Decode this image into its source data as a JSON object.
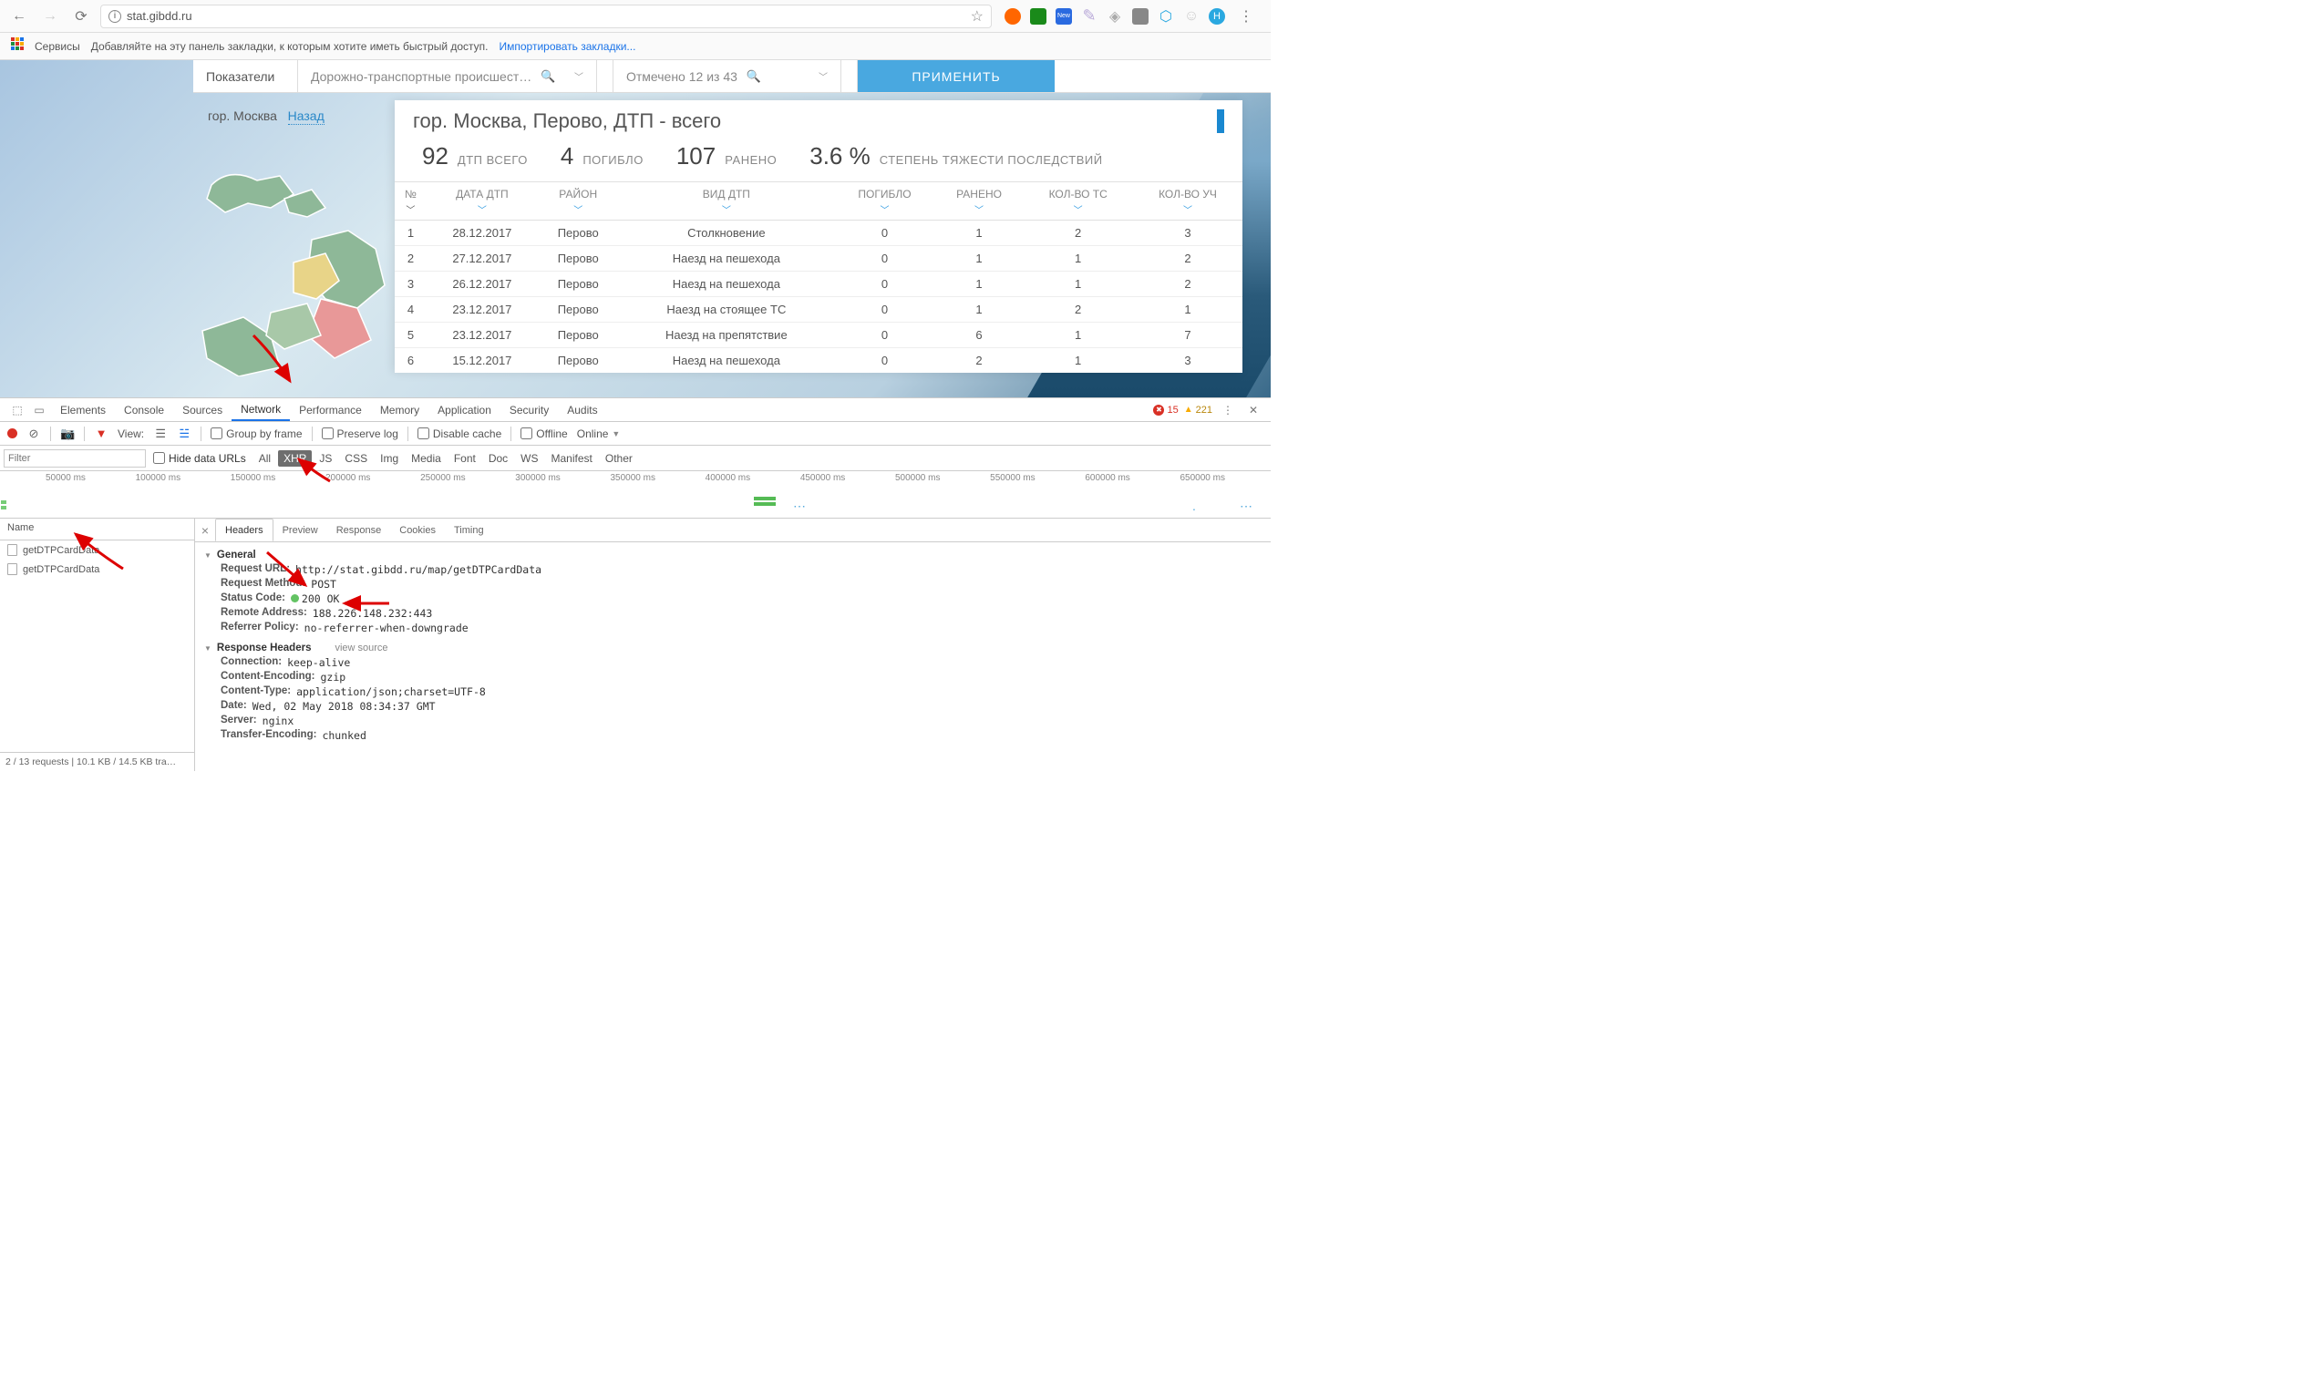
{
  "browser": {
    "url": "stat.gibdd.ru",
    "star_icon": "☆",
    "ext_icons": [
      "dots",
      "orange",
      "green",
      "blue-new",
      "lavender",
      "grey-tri",
      "evernote",
      "shield",
      "ghost",
      "H"
    ]
  },
  "bookmarks": {
    "services_label": "Сервисы",
    "hint_text": "Добавляйте на эту панель закладки, к которым хотите иметь быстрый доступ.",
    "import_link": "Импортировать закладки..."
  },
  "top_controls": {
    "indicators": "Показатели",
    "dtp_filter": "Дорожно-транспортные происшест…",
    "selected": "Отмечено 12 из 43",
    "apply": "ПРИМЕНИТЬ"
  },
  "breadcrumb": {
    "city": "гор. Москва",
    "back": "Назад"
  },
  "panel": {
    "title": "гор. Москва, Перово, ДТП - всего",
    "stats": [
      {
        "n": "92",
        "lbl": "ДТП ВСЕГО"
      },
      {
        "n": "4",
        "lbl": "ПОГИБЛО"
      },
      {
        "n": "107",
        "lbl": "РАНЕНО"
      },
      {
        "n": "3.6 %",
        "lbl": "СТЕПЕНЬ ТЯЖЕСТИ ПОСЛЕДСТВИЙ"
      }
    ],
    "columns": [
      "№",
      "ДАТА ДТП",
      "РАЙОН",
      "ВИД ДТП",
      "ПОГИБЛО",
      "РАНЕНО",
      "КОЛ-ВО ТС",
      "КОЛ-ВО УЧ"
    ],
    "rows": [
      [
        "1",
        "28.12.2017",
        "Перово",
        "Столкновение",
        "0",
        "1",
        "2",
        "3"
      ],
      [
        "2",
        "27.12.2017",
        "Перово",
        "Наезд на пешехода",
        "0",
        "1",
        "1",
        "2"
      ],
      [
        "3",
        "26.12.2017",
        "Перово",
        "Наезд на пешехода",
        "0",
        "1",
        "1",
        "2"
      ],
      [
        "4",
        "23.12.2017",
        "Перово",
        "Наезд на стоящее ТС",
        "0",
        "1",
        "2",
        "1"
      ],
      [
        "5",
        "23.12.2017",
        "Перово",
        "Наезд на препятствие",
        "0",
        "6",
        "1",
        "7"
      ],
      [
        "6",
        "15.12.2017",
        "Перово",
        "Наезд на пешехода",
        "0",
        "2",
        "1",
        "3"
      ]
    ]
  },
  "devtools": {
    "tabs": [
      "Elements",
      "Console",
      "Sources",
      "Network",
      "Performance",
      "Memory",
      "Application",
      "Security",
      "Audits"
    ],
    "active_tab": "Network",
    "errors": "15",
    "warnings": "221",
    "toolbar": {
      "view_label": "View:",
      "group": "Group by frame",
      "preserve": "Preserve log",
      "disable_cache": "Disable cache",
      "offline": "Offline",
      "online": "Online"
    },
    "filter": {
      "placeholder": "Filter",
      "hide_urls": "Hide data URLs",
      "types": [
        "All",
        "XHR",
        "JS",
        "CSS",
        "Img",
        "Media",
        "Font",
        "Doc",
        "WS",
        "Manifest",
        "Other"
      ],
      "active_type": "XHR"
    },
    "timeline_ticks": [
      "50000 ms",
      "100000 ms",
      "150000 ms",
      "200000 ms",
      "250000 ms",
      "300000 ms",
      "350000 ms",
      "400000 ms",
      "450000 ms",
      "500000 ms",
      "550000 ms",
      "600000 ms",
      "650000 ms"
    ],
    "requests": {
      "name_col": "Name",
      "items": [
        "getDTPCardData",
        "getDTPCardData"
      ],
      "footer": "2 / 13 requests  |  10.1 KB / 14.5 KB tra…"
    },
    "detail_tabs": [
      "Headers",
      "Preview",
      "Response",
      "Cookies",
      "Timing"
    ],
    "active_detail": "Headers",
    "headers": {
      "general_title": "General",
      "general": [
        {
          "k": "Request URL:",
          "v": "http://stat.gibdd.ru/map/getDTPCardData"
        },
        {
          "k": "Request Method:",
          "v": "POST"
        },
        {
          "k": "Status Code:",
          "v": "200 OK",
          "status": true
        },
        {
          "k": "Remote Address:",
          "v": "188.226.148.232:443"
        },
        {
          "k": "Referrer Policy:",
          "v": "no-referrer-when-downgrade"
        }
      ],
      "response_title": "Response Headers",
      "view_source": "view source",
      "response": [
        {
          "k": "Connection:",
          "v": "keep-alive"
        },
        {
          "k": "Content-Encoding:",
          "v": "gzip"
        },
        {
          "k": "Content-Type:",
          "v": "application/json;charset=UTF-8"
        },
        {
          "k": "Date:",
          "v": "Wed, 02 May 2018 08:34:37 GMT"
        },
        {
          "k": "Server:",
          "v": "nginx"
        },
        {
          "k": "Transfer-Encoding:",
          "v": "chunked"
        }
      ]
    }
  }
}
